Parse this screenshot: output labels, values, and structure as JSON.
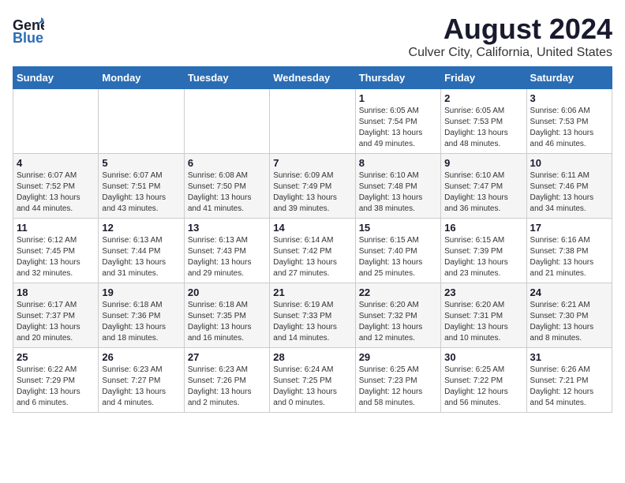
{
  "header": {
    "logo_general": "General",
    "logo_blue": "Blue",
    "title": "August 2024",
    "subtitle": "Culver City, California, United States"
  },
  "calendar": {
    "days_of_week": [
      "Sunday",
      "Monday",
      "Tuesday",
      "Wednesday",
      "Thursday",
      "Friday",
      "Saturday"
    ],
    "weeks": [
      [
        {
          "day": "",
          "info": ""
        },
        {
          "day": "",
          "info": ""
        },
        {
          "day": "",
          "info": ""
        },
        {
          "day": "",
          "info": ""
        },
        {
          "day": "1",
          "info": "Sunrise: 6:05 AM\nSunset: 7:54 PM\nDaylight: 13 hours\nand 49 minutes."
        },
        {
          "day": "2",
          "info": "Sunrise: 6:05 AM\nSunset: 7:53 PM\nDaylight: 13 hours\nand 48 minutes."
        },
        {
          "day": "3",
          "info": "Sunrise: 6:06 AM\nSunset: 7:53 PM\nDaylight: 13 hours\nand 46 minutes."
        }
      ],
      [
        {
          "day": "4",
          "info": "Sunrise: 6:07 AM\nSunset: 7:52 PM\nDaylight: 13 hours\nand 44 minutes."
        },
        {
          "day": "5",
          "info": "Sunrise: 6:07 AM\nSunset: 7:51 PM\nDaylight: 13 hours\nand 43 minutes."
        },
        {
          "day": "6",
          "info": "Sunrise: 6:08 AM\nSunset: 7:50 PM\nDaylight: 13 hours\nand 41 minutes."
        },
        {
          "day": "7",
          "info": "Sunrise: 6:09 AM\nSunset: 7:49 PM\nDaylight: 13 hours\nand 39 minutes."
        },
        {
          "day": "8",
          "info": "Sunrise: 6:10 AM\nSunset: 7:48 PM\nDaylight: 13 hours\nand 38 minutes."
        },
        {
          "day": "9",
          "info": "Sunrise: 6:10 AM\nSunset: 7:47 PM\nDaylight: 13 hours\nand 36 minutes."
        },
        {
          "day": "10",
          "info": "Sunrise: 6:11 AM\nSunset: 7:46 PM\nDaylight: 13 hours\nand 34 minutes."
        }
      ],
      [
        {
          "day": "11",
          "info": "Sunrise: 6:12 AM\nSunset: 7:45 PM\nDaylight: 13 hours\nand 32 minutes."
        },
        {
          "day": "12",
          "info": "Sunrise: 6:13 AM\nSunset: 7:44 PM\nDaylight: 13 hours\nand 31 minutes."
        },
        {
          "day": "13",
          "info": "Sunrise: 6:13 AM\nSunset: 7:43 PM\nDaylight: 13 hours\nand 29 minutes."
        },
        {
          "day": "14",
          "info": "Sunrise: 6:14 AM\nSunset: 7:42 PM\nDaylight: 13 hours\nand 27 minutes."
        },
        {
          "day": "15",
          "info": "Sunrise: 6:15 AM\nSunset: 7:40 PM\nDaylight: 13 hours\nand 25 minutes."
        },
        {
          "day": "16",
          "info": "Sunrise: 6:15 AM\nSunset: 7:39 PM\nDaylight: 13 hours\nand 23 minutes."
        },
        {
          "day": "17",
          "info": "Sunrise: 6:16 AM\nSunset: 7:38 PM\nDaylight: 13 hours\nand 21 minutes."
        }
      ],
      [
        {
          "day": "18",
          "info": "Sunrise: 6:17 AM\nSunset: 7:37 PM\nDaylight: 13 hours\nand 20 minutes."
        },
        {
          "day": "19",
          "info": "Sunrise: 6:18 AM\nSunset: 7:36 PM\nDaylight: 13 hours\nand 18 minutes."
        },
        {
          "day": "20",
          "info": "Sunrise: 6:18 AM\nSunset: 7:35 PM\nDaylight: 13 hours\nand 16 minutes."
        },
        {
          "day": "21",
          "info": "Sunrise: 6:19 AM\nSunset: 7:33 PM\nDaylight: 13 hours\nand 14 minutes."
        },
        {
          "day": "22",
          "info": "Sunrise: 6:20 AM\nSunset: 7:32 PM\nDaylight: 13 hours\nand 12 minutes."
        },
        {
          "day": "23",
          "info": "Sunrise: 6:20 AM\nSunset: 7:31 PM\nDaylight: 13 hours\nand 10 minutes."
        },
        {
          "day": "24",
          "info": "Sunrise: 6:21 AM\nSunset: 7:30 PM\nDaylight: 13 hours\nand 8 minutes."
        }
      ],
      [
        {
          "day": "25",
          "info": "Sunrise: 6:22 AM\nSunset: 7:29 PM\nDaylight: 13 hours\nand 6 minutes."
        },
        {
          "day": "26",
          "info": "Sunrise: 6:23 AM\nSunset: 7:27 PM\nDaylight: 13 hours\nand 4 minutes."
        },
        {
          "day": "27",
          "info": "Sunrise: 6:23 AM\nSunset: 7:26 PM\nDaylight: 13 hours\nand 2 minutes."
        },
        {
          "day": "28",
          "info": "Sunrise: 6:24 AM\nSunset: 7:25 PM\nDaylight: 13 hours\nand 0 minutes."
        },
        {
          "day": "29",
          "info": "Sunrise: 6:25 AM\nSunset: 7:23 PM\nDaylight: 12 hours\nand 58 minutes."
        },
        {
          "day": "30",
          "info": "Sunrise: 6:25 AM\nSunset: 7:22 PM\nDaylight: 12 hours\nand 56 minutes."
        },
        {
          "day": "31",
          "info": "Sunrise: 6:26 AM\nSunset: 7:21 PM\nDaylight: 12 hours\nand 54 minutes."
        }
      ]
    ]
  }
}
